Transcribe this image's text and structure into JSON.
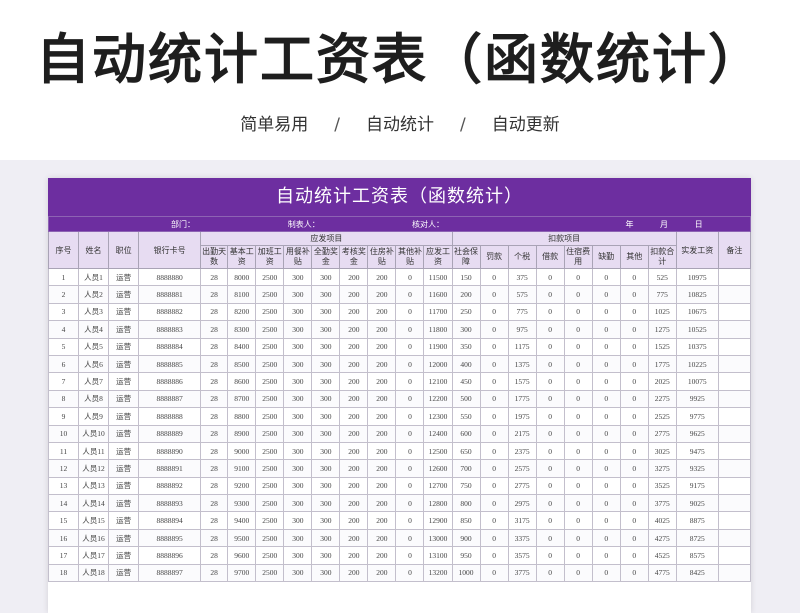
{
  "banner": {
    "title": "自动统计工资表（函数统计）",
    "tagline": [
      "简单易用",
      "自动统计",
      "自动更新"
    ],
    "separator": "/"
  },
  "sheet": {
    "title": "自动统计工资表（函数统计）",
    "meta": {
      "department": "部门：",
      "preparer": "制表人：",
      "checker": "核对人：",
      "year": "年",
      "month": "月",
      "day": "日"
    },
    "colors": {
      "header_band": "#6d2ea0",
      "header_cells": "#e7dcf2",
      "grid": "#a9a3b6"
    },
    "group_headers": {
      "payable": "应发项目",
      "deduction": "扣款项目"
    },
    "columns": {
      "seq": "序号",
      "name": "姓名",
      "position": "职位",
      "bank_card": "银行卡号",
      "attendance_days": "出勤天数",
      "base_salary": "基本工资",
      "overtime_pay": "加班工资",
      "meal_allowance": "用餐补贴",
      "attendance_bonus": "全勤奖金",
      "appraisal_bonus": "考核奖金",
      "housing_allowance": "住房补贴",
      "other_allowance": "其他补贴",
      "gross_pay": "应发工资",
      "social_security": "社会保障",
      "fine": "罚款",
      "income_tax": "个税",
      "loan": "借款",
      "dorm_fee": "住宿费用",
      "absence": "缺勤",
      "other_deduction": "其他",
      "deduction_total": "扣款合计",
      "net_pay": "实发工资",
      "remark": "备注"
    },
    "rows": [
      [
        "1",
        "人员1",
        "运营",
        "8888880",
        "28",
        "8000",
        "2500",
        "300",
        "300",
        "200",
        "200",
        "0",
        "11500",
        "150",
        "0",
        "375",
        "0",
        "0",
        "0",
        "0",
        "525",
        "10975",
        ""
      ],
      [
        "2",
        "人员2",
        "运营",
        "8888881",
        "28",
        "8100",
        "2500",
        "300",
        "300",
        "200",
        "200",
        "0",
        "11600",
        "200",
        "0",
        "575",
        "0",
        "0",
        "0",
        "0",
        "775",
        "10825",
        ""
      ],
      [
        "3",
        "人员3",
        "运营",
        "8888882",
        "28",
        "8200",
        "2500",
        "300",
        "300",
        "200",
        "200",
        "0",
        "11700",
        "250",
        "0",
        "775",
        "0",
        "0",
        "0",
        "0",
        "1025",
        "10675",
        ""
      ],
      [
        "4",
        "人员4",
        "运营",
        "8888883",
        "28",
        "8300",
        "2500",
        "300",
        "300",
        "200",
        "200",
        "0",
        "11800",
        "300",
        "0",
        "975",
        "0",
        "0",
        "0",
        "0",
        "1275",
        "10525",
        ""
      ],
      [
        "5",
        "人员5",
        "运营",
        "8888884",
        "28",
        "8400",
        "2500",
        "300",
        "300",
        "200",
        "200",
        "0",
        "11900",
        "350",
        "0",
        "1175",
        "0",
        "0",
        "0",
        "0",
        "1525",
        "10375",
        ""
      ],
      [
        "6",
        "人员6",
        "运营",
        "8888885",
        "28",
        "8500",
        "2500",
        "300",
        "300",
        "200",
        "200",
        "0",
        "12000",
        "400",
        "0",
        "1375",
        "0",
        "0",
        "0",
        "0",
        "1775",
        "10225",
        ""
      ],
      [
        "7",
        "人员7",
        "运营",
        "8888886",
        "28",
        "8600",
        "2500",
        "300",
        "300",
        "200",
        "200",
        "0",
        "12100",
        "450",
        "0",
        "1575",
        "0",
        "0",
        "0",
        "0",
        "2025",
        "10075",
        ""
      ],
      [
        "8",
        "人员8",
        "运营",
        "8888887",
        "28",
        "8700",
        "2500",
        "300",
        "300",
        "200",
        "200",
        "0",
        "12200",
        "500",
        "0",
        "1775",
        "0",
        "0",
        "0",
        "0",
        "2275",
        "9925",
        ""
      ],
      [
        "9",
        "人员9",
        "运营",
        "8888888",
        "28",
        "8800",
        "2500",
        "300",
        "300",
        "200",
        "200",
        "0",
        "12300",
        "550",
        "0",
        "1975",
        "0",
        "0",
        "0",
        "0",
        "2525",
        "9775",
        ""
      ],
      [
        "10",
        "人员10",
        "运营",
        "8888889",
        "28",
        "8900",
        "2500",
        "300",
        "300",
        "200",
        "200",
        "0",
        "12400",
        "600",
        "0",
        "2175",
        "0",
        "0",
        "0",
        "0",
        "2775",
        "9625",
        ""
      ],
      [
        "11",
        "人员11",
        "运营",
        "8888890",
        "28",
        "9000",
        "2500",
        "300",
        "300",
        "200",
        "200",
        "0",
        "12500",
        "650",
        "0",
        "2375",
        "0",
        "0",
        "0",
        "0",
        "3025",
        "9475",
        ""
      ],
      [
        "12",
        "人员12",
        "运营",
        "8888891",
        "28",
        "9100",
        "2500",
        "300",
        "300",
        "200",
        "200",
        "0",
        "12600",
        "700",
        "0",
        "2575",
        "0",
        "0",
        "0",
        "0",
        "3275",
        "9325",
        ""
      ],
      [
        "13",
        "人员13",
        "运营",
        "8888892",
        "28",
        "9200",
        "2500",
        "300",
        "300",
        "200",
        "200",
        "0",
        "12700",
        "750",
        "0",
        "2775",
        "0",
        "0",
        "0",
        "0",
        "3525",
        "9175",
        ""
      ],
      [
        "14",
        "人员14",
        "运营",
        "8888893",
        "28",
        "9300",
        "2500",
        "300",
        "300",
        "200",
        "200",
        "0",
        "12800",
        "800",
        "0",
        "2975",
        "0",
        "0",
        "0",
        "0",
        "3775",
        "9025",
        ""
      ],
      [
        "15",
        "人员15",
        "运营",
        "8888894",
        "28",
        "9400",
        "2500",
        "300",
        "300",
        "200",
        "200",
        "0",
        "12900",
        "850",
        "0",
        "3175",
        "0",
        "0",
        "0",
        "0",
        "4025",
        "8875",
        ""
      ],
      [
        "16",
        "人员16",
        "运营",
        "8888895",
        "28",
        "9500",
        "2500",
        "300",
        "300",
        "200",
        "200",
        "0",
        "13000",
        "900",
        "0",
        "3375",
        "0",
        "0",
        "0",
        "0",
        "4275",
        "8725",
        ""
      ],
      [
        "17",
        "人员17",
        "运营",
        "8888896",
        "28",
        "9600",
        "2500",
        "300",
        "300",
        "200",
        "200",
        "0",
        "13100",
        "950",
        "0",
        "3575",
        "0",
        "0",
        "0",
        "0",
        "4525",
        "8575",
        ""
      ],
      [
        "18",
        "人员18",
        "运营",
        "8888897",
        "28",
        "9700",
        "2500",
        "300",
        "300",
        "200",
        "200",
        "0",
        "13200",
        "1000",
        "0",
        "3775",
        "0",
        "0",
        "0",
        "0",
        "4775",
        "8425",
        ""
      ]
    ]
  }
}
